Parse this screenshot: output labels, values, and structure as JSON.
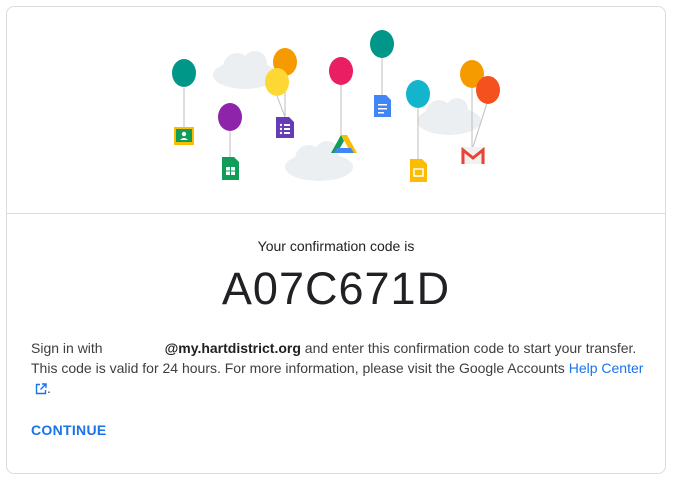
{
  "confirmation": {
    "label": "Your confirmation code is",
    "code": "A07C671D"
  },
  "message": {
    "part1": "Sign in with",
    "email": "@my.hartdistrict.org",
    "part2": " and enter this confirmation code to start your transfer. This code is valid for 24 hours. For more information, please visit the Google Accounts ",
    "link_text": "Help Center",
    "period": "."
  },
  "actions": {
    "continue_label": "CONTINUE"
  },
  "colors": {
    "accent": "#1a73e8",
    "divider": "#dadce0",
    "balloon_teal": "#009688",
    "balloon_orange": "#f59b00",
    "balloon_yellow": "#fdd835",
    "balloon_purple": "#8e24aa",
    "balloon_pink": "#e91e63",
    "balloon_cyan": "#12b5cb",
    "balloon_red": "#f4511e"
  },
  "icons": [
    "classroom-icon",
    "sheets-icon",
    "forms-icon",
    "drive-icon",
    "docs-icon",
    "slides-icon",
    "gmail-icon",
    "external-link-icon"
  ]
}
